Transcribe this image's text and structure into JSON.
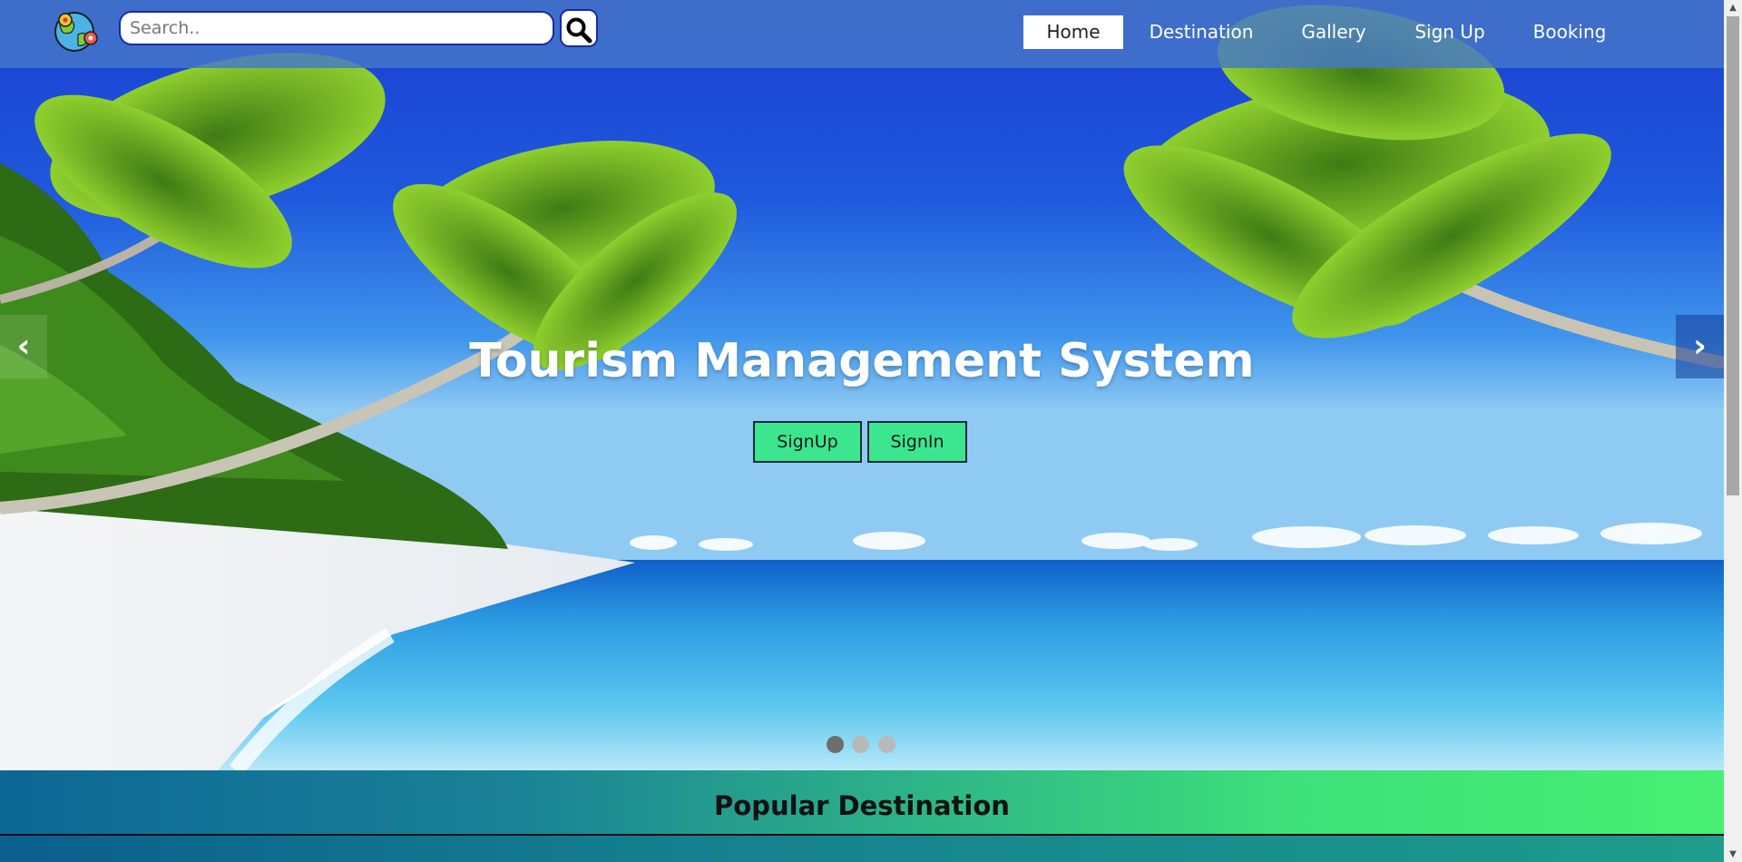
{
  "navbar": {
    "logo_icon": "globe-map-icon",
    "search": {
      "placeholder": "Search..",
      "value": "",
      "button_icon": "search-icon"
    },
    "items": [
      {
        "label": "Home",
        "active": true
      },
      {
        "label": "Destination",
        "active": false
      },
      {
        "label": "Gallery",
        "active": false
      },
      {
        "label": "Sign Up",
        "active": false
      },
      {
        "label": "Booking",
        "active": false
      }
    ]
  },
  "hero": {
    "title": "Tourism Management System",
    "buttons": {
      "signup": "SignUp",
      "signin": "SignIn"
    },
    "prev_arrow": "‹",
    "next_arrow": "›",
    "slides_count": 3,
    "active_slide": 1
  },
  "popular": {
    "title": "Popular Destination"
  },
  "colors": {
    "navbar_bg": "#4678c8",
    "button_bg": "#3ce68f",
    "gradient_start": "#0d6795",
    "gradient_end": "#47f072"
  }
}
